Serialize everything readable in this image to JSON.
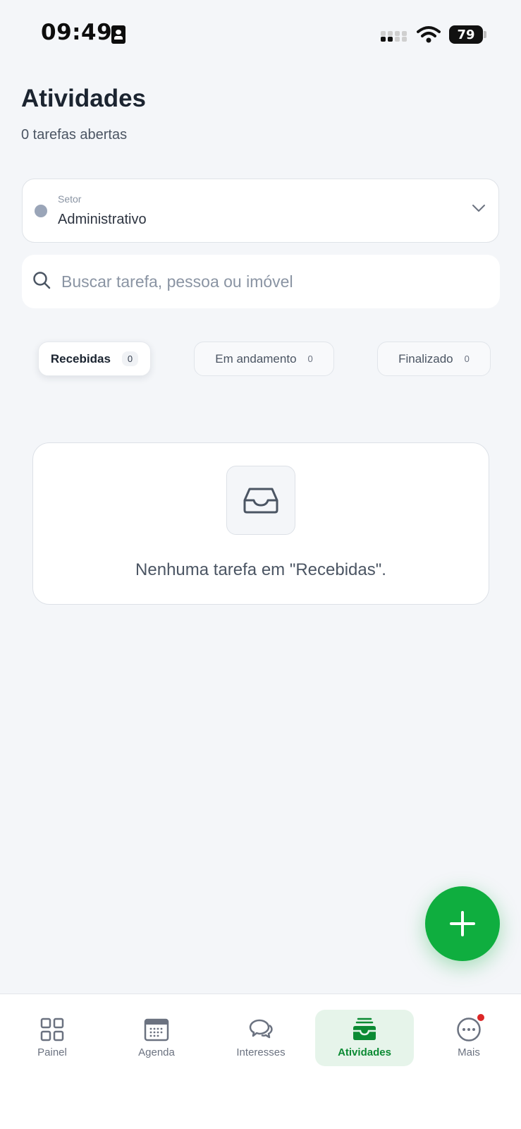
{
  "status_bar": {
    "time": "09:49",
    "battery": "79"
  },
  "header": {
    "title": "Atividades",
    "subtitle": "0 tarefas abertas"
  },
  "sector": {
    "label": "Setor",
    "value": "Administrativo"
  },
  "search": {
    "placeholder": "Buscar tarefa, pessoa ou imóvel"
  },
  "tabs": [
    {
      "label": "Recebidas",
      "count": "0",
      "active": true
    },
    {
      "label": "Em andamento",
      "count": "0",
      "active": false
    },
    {
      "label": "Finalizado",
      "count": "0",
      "active": false
    }
  ],
  "empty_state": {
    "message": "Nenhuma tarefa em \"Recebidas\".",
    "icon": "inbox-icon"
  },
  "fab": {
    "icon": "plus-icon"
  },
  "bottom_nav": [
    {
      "label": "Painel",
      "icon": "grid-icon"
    },
    {
      "label": "Agenda",
      "icon": "calendar-icon"
    },
    {
      "label": "Interesses",
      "icon": "chat-bubbles-icon"
    },
    {
      "label": "Atividades",
      "icon": "inbox-icon",
      "active": true
    },
    {
      "label": "Mais",
      "icon": "more-icon",
      "has_notification": true
    }
  ],
  "colors": {
    "accent_green": "#0fae3f",
    "active_nav_bg": "#e6f4ea",
    "active_nav_text": "#0b8a33",
    "notification": "#dc2626",
    "background": "#f4f6f9"
  }
}
